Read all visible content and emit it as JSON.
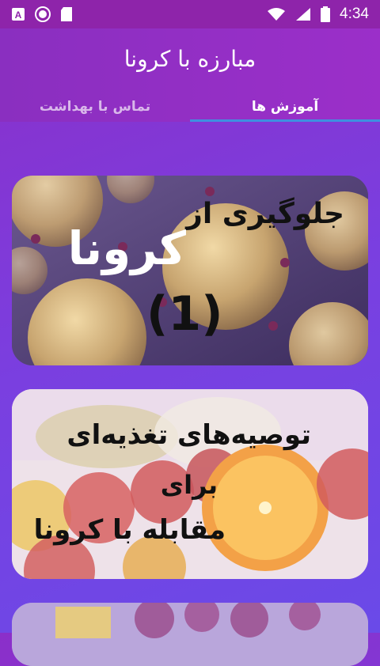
{
  "status_bar": {
    "time": "4:34",
    "left_icons": [
      "accessibility-icon",
      "record-icon",
      "sd-card-icon"
    ],
    "right_icons": [
      "wifi-icon",
      "signal-icon",
      "battery-icon"
    ]
  },
  "app_bar": {
    "title": "مبارزه با کرونا"
  },
  "tabs": [
    {
      "label": "آموزش ها",
      "active": true
    },
    {
      "label": "تماس با بهداشت",
      "active": false
    }
  ],
  "cards": [
    {
      "lines": [
        "جلوگیری از",
        "کرونا",
        "(1)"
      ],
      "image": "coronavirus-image"
    },
    {
      "lines": [
        "توصیه‌های تغذیه‌ای",
        "برای",
        "مقابله با کرونا"
      ],
      "image": "fruits-image"
    },
    {
      "lines": [],
      "image": "food-image"
    }
  ],
  "colors": {
    "status_bar": "#8e24aa",
    "app_bar": "#9b2fc9",
    "tab_indicator": "#3f8fe0",
    "background": "#7a3fe0"
  }
}
